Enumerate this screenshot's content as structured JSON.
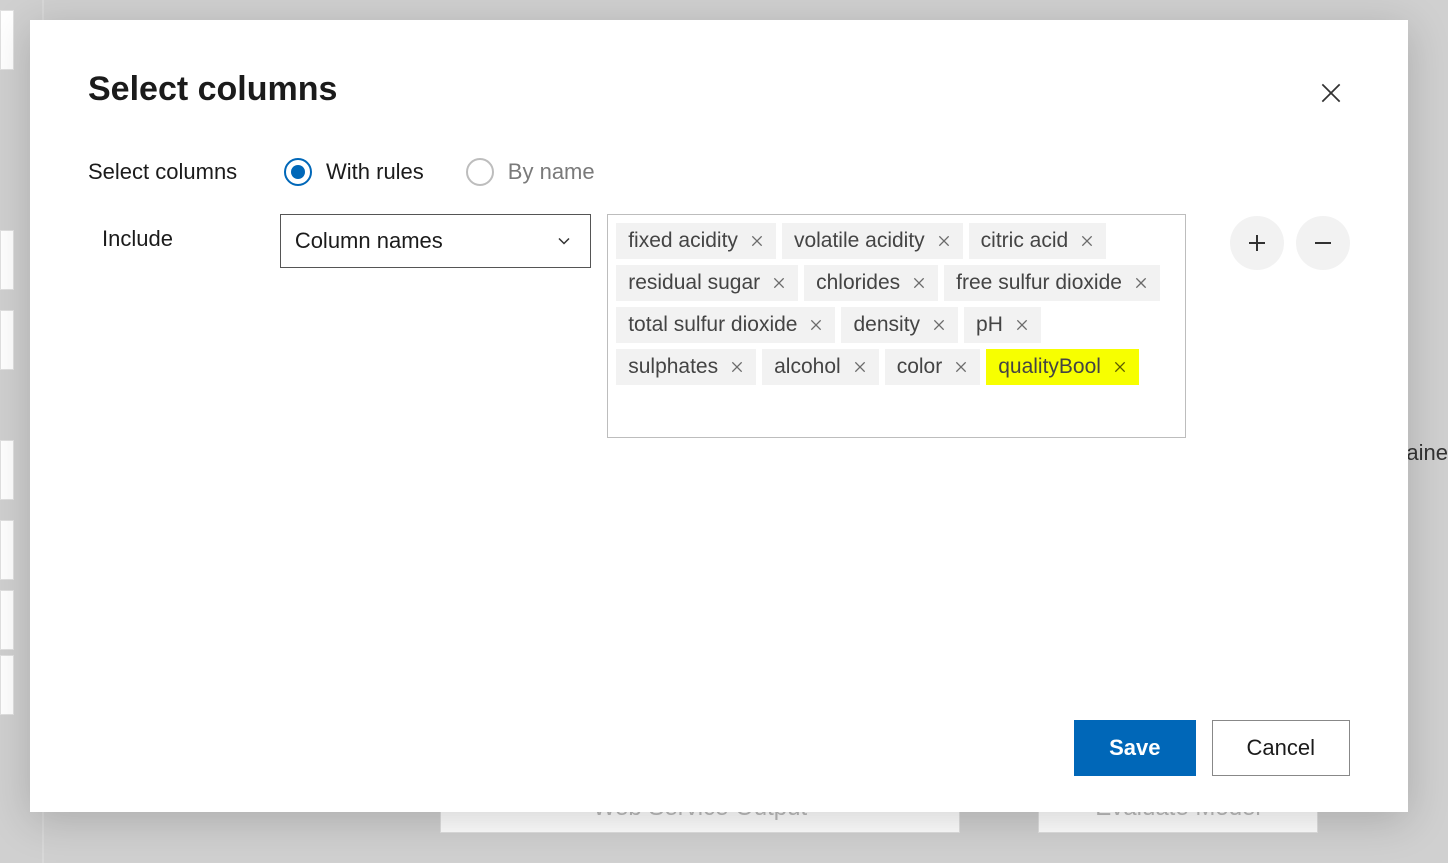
{
  "dialog": {
    "title": "Select columns",
    "select_columns_label": "Select columns",
    "radio_options": [
      {
        "id": "with-rules",
        "label": "With rules",
        "selected": true
      },
      {
        "id": "by-name",
        "label": "By name",
        "selected": false
      }
    ],
    "include_label": "Include",
    "dropdown_value": "Column names",
    "tags": [
      {
        "label": "fixed acidity",
        "highlight": false
      },
      {
        "label": "volatile acidity",
        "highlight": false
      },
      {
        "label": "citric acid",
        "highlight": false
      },
      {
        "label": "residual sugar",
        "highlight": false
      },
      {
        "label": "chlorides",
        "highlight": false
      },
      {
        "label": "free sulfur dioxide",
        "highlight": false
      },
      {
        "label": "total sulfur dioxide",
        "highlight": false
      },
      {
        "label": "density",
        "highlight": false
      },
      {
        "label": "pH",
        "highlight": false
      },
      {
        "label": "sulphates",
        "highlight": false
      },
      {
        "label": "alcohol",
        "highlight": false
      },
      {
        "label": "color",
        "highlight": false
      },
      {
        "label": "qualityBool",
        "highlight": true
      }
    ],
    "buttons": {
      "save": "Save",
      "cancel": "Cancel"
    }
  },
  "background": {
    "right_text": "aine",
    "bottom_text_1": "Web Service Output",
    "bottom_text_2": "Evaluate Model"
  }
}
